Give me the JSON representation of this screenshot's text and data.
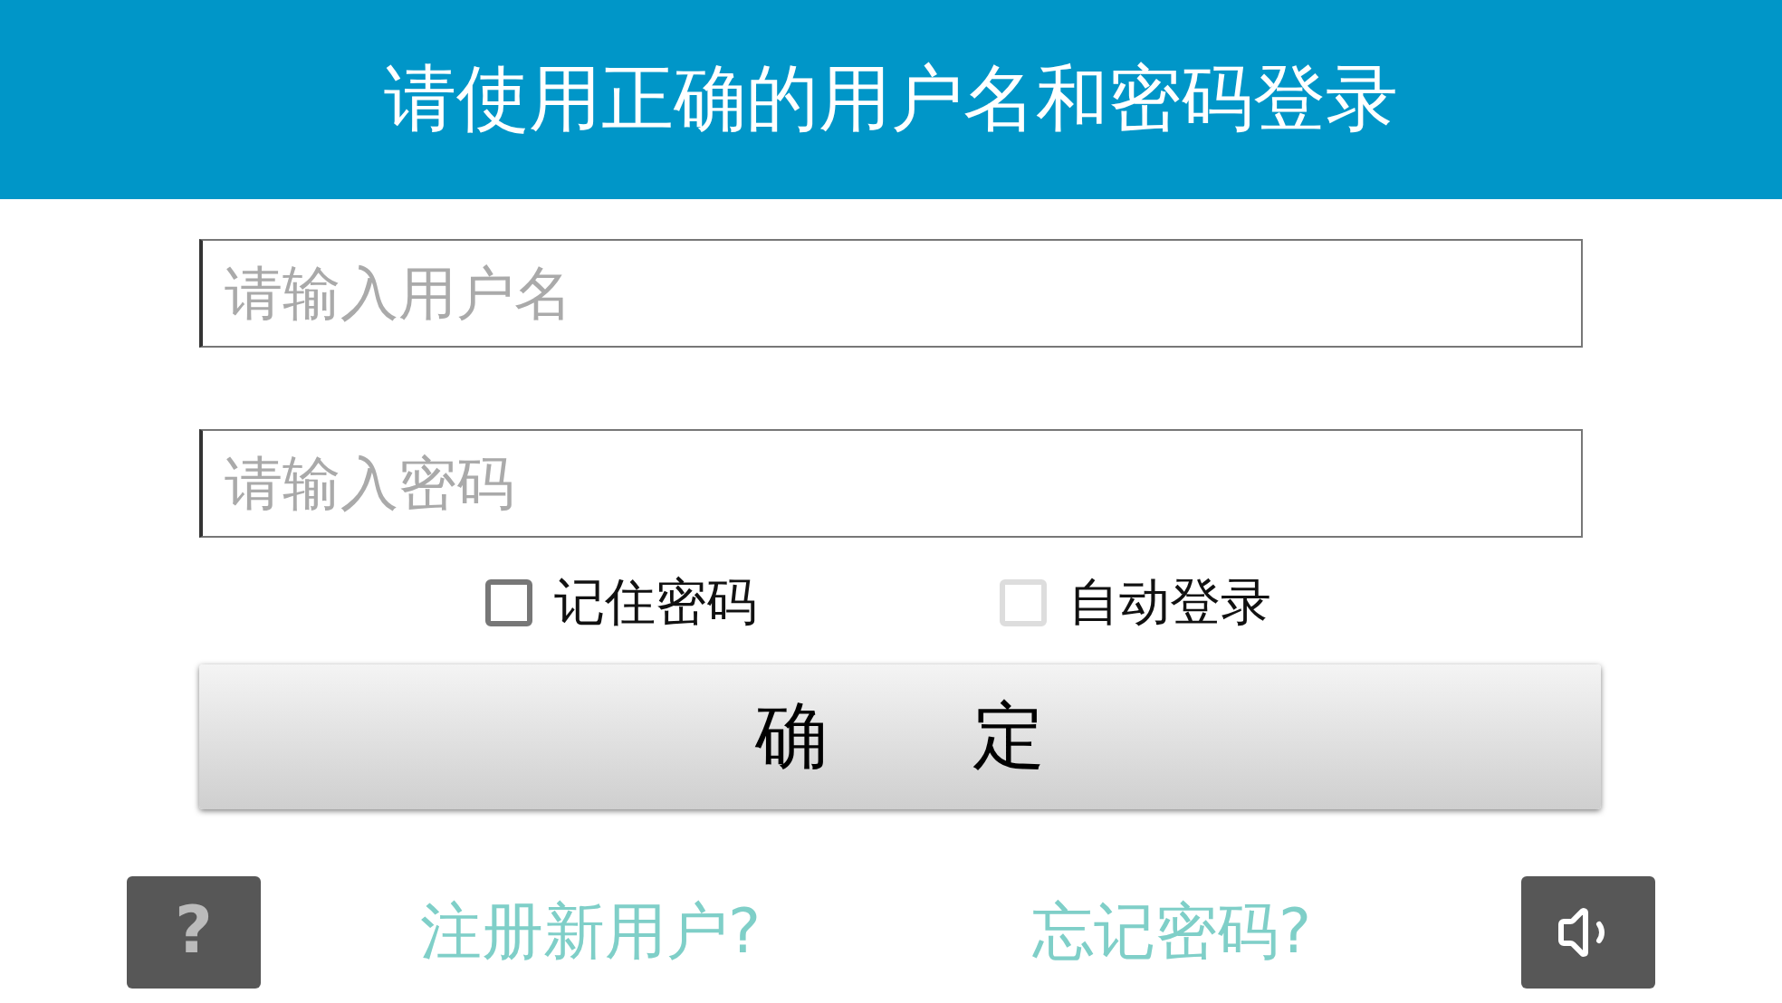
{
  "header": {
    "title": "请使用正确的用户名和密码登录"
  },
  "fields": [
    {
      "placeholder": "请输入用户名"
    },
    {
      "placeholder": "请输入密码"
    }
  ],
  "options": [
    {
      "label": "记住密码",
      "checked": false,
      "disabled": false
    },
    {
      "label": "自动登录",
      "checked": false,
      "disabled": true
    }
  ],
  "confirm_button": "确　　定",
  "footer": {
    "help_button": "?",
    "links": [
      "注册新用户?",
      "忘记密码?"
    ]
  }
}
